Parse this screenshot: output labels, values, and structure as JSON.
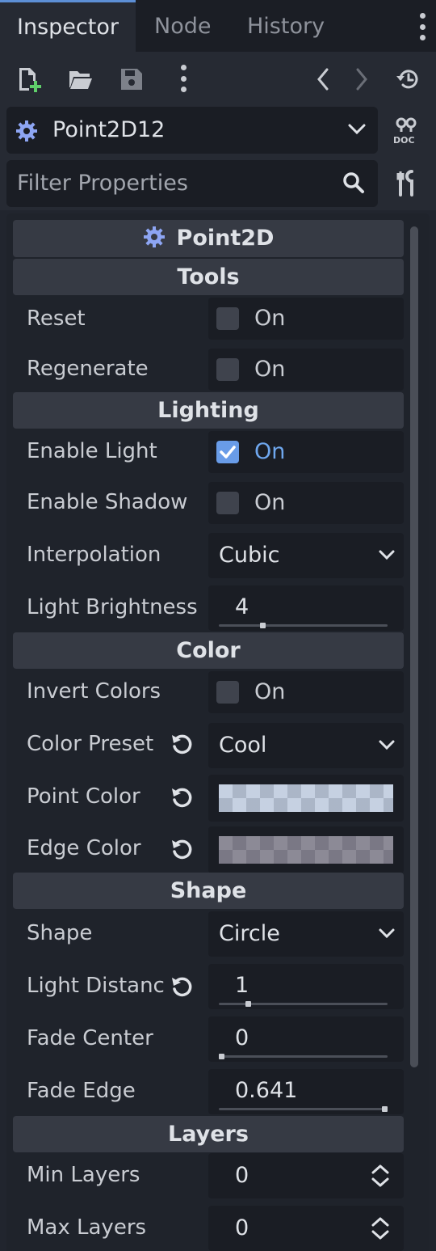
{
  "tabs": [
    {
      "label": "Inspector",
      "active": true
    },
    {
      "label": "Node",
      "active": false
    },
    {
      "label": "History",
      "active": false
    }
  ],
  "node_selector": {
    "name": "Point2D12"
  },
  "filter": {
    "placeholder": "Filter Properties"
  },
  "class_header": "Point2D",
  "sections": {
    "tools": "Tools",
    "lighting": "Lighting",
    "color": "Color",
    "shape": "Shape",
    "layers": "Layers"
  },
  "properties": {
    "reset": {
      "label": "Reset",
      "checked": false,
      "value_label": "On"
    },
    "regenerate": {
      "label": "Regenerate",
      "checked": false,
      "value_label": "On"
    },
    "enable_light": {
      "label": "Enable Light",
      "checked": true,
      "value_label": "On"
    },
    "enable_shadow": {
      "label": "Enable Shadow",
      "checked": false,
      "value_label": "On"
    },
    "interpolation": {
      "label": "Interpolation",
      "value": "Cubic"
    },
    "light_brightness": {
      "label": "Light Brightness",
      "value": "4",
      "slider_fraction": 0.26
    },
    "invert_colors": {
      "label": "Invert Colors",
      "checked": false,
      "value_label": "On"
    },
    "color_preset": {
      "label": "Color Preset",
      "value": "Cool"
    },
    "point_color": {
      "label": "Point Color",
      "color": "#b9cde6"
    },
    "edge_color": {
      "label": "Edge Color",
      "color": "#6c6a79"
    },
    "shape": {
      "label": "Shape",
      "value": "Circle"
    },
    "light_distance": {
      "label": "Light Distanc",
      "value": "1",
      "slider_fraction": 0.17
    },
    "fade_center": {
      "label": "Fade Center",
      "value": "0",
      "slider_fraction": 0.0
    },
    "fade_edge": {
      "label": "Fade Edge",
      "value": "0.641",
      "slider_fraction": 1.0
    },
    "min_layers": {
      "label": "Min Layers",
      "value": "0"
    },
    "max_layers": {
      "label": "Max Layers",
      "value": "0"
    }
  },
  "colors": {
    "accent": "#699ce8",
    "class_icon": "#8da5f3",
    "add_icon": "#5fcf6a"
  },
  "icons": [
    "new-script-icon",
    "open-folder-icon",
    "save-icon",
    "kebab-menu-icon",
    "back-arrow-icon",
    "forward-arrow-icon",
    "history-icon",
    "gear-icon",
    "chevron-down-icon",
    "doc-icon",
    "search-icon",
    "tools-icon",
    "reset-icon",
    "checkmark-icon",
    "spinner-icon"
  ]
}
